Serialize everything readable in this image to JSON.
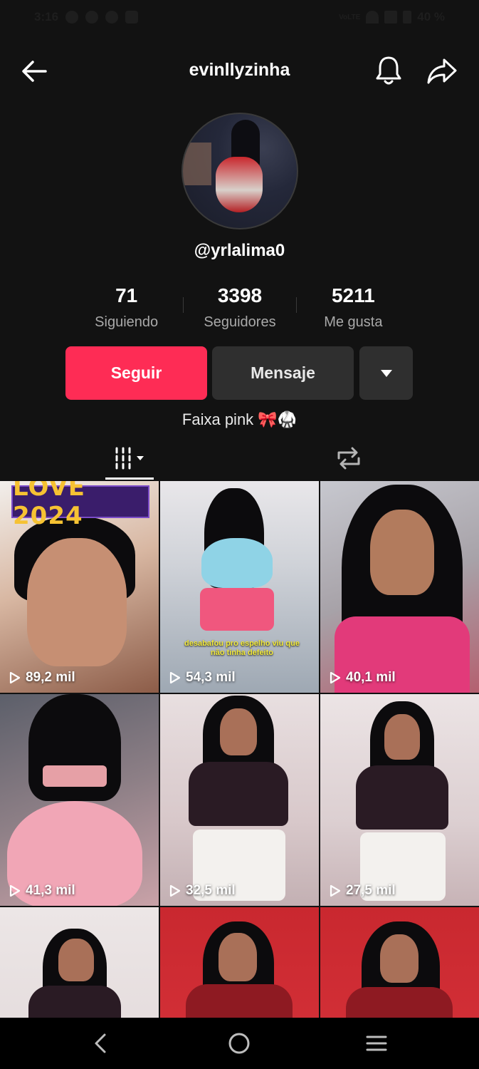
{
  "status_bar": {
    "time": "3:16",
    "battery": "40 %",
    "network_label": "VoLTE"
  },
  "header": {
    "username": "evinllyzinha",
    "icons": [
      "back-arrow-icon",
      "bell-icon",
      "share-icon"
    ]
  },
  "profile": {
    "handle": "@yrlalima0",
    "bio": "Faixa pink 🎀🥋"
  },
  "stats": [
    {
      "value": "71",
      "label": "Siguiendo"
    },
    {
      "value": "3398",
      "label": "Seguidores"
    },
    {
      "value": "5211",
      "label": "Me gusta"
    }
  ],
  "actions": {
    "follow_label": "Seguir",
    "message_label": "Mensaje"
  },
  "tabs": {
    "videos_icon": "grid-icon",
    "reposts_icon": "repost-icon"
  },
  "videos": [
    {
      "views": "89,2 mil",
      "overlay": "LOVE 2024"
    },
    {
      "views": "54,3 mil",
      "caption": "desabafou pro espelho viu que não tinha defeito"
    },
    {
      "views": "40,1 mil"
    },
    {
      "views": "41,3 mil"
    },
    {
      "views": "32,5 mil"
    },
    {
      "views": "27,5 mil"
    },
    {
      "views": ""
    },
    {
      "views": ""
    },
    {
      "views": ""
    }
  ],
  "colors": {
    "background": "#121212",
    "follow_button": "#fe2c55",
    "secondary_button": "#2f2f2f"
  }
}
